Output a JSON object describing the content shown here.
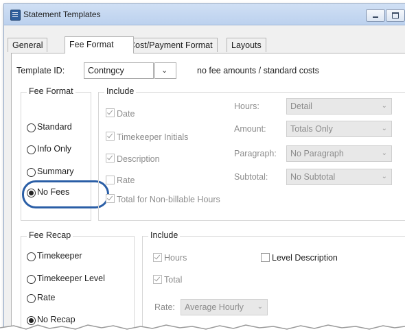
{
  "window": {
    "title": "Statement Templates"
  },
  "tabs": [
    "General",
    "Fee Format",
    "Cost/Payment Format",
    "Layouts"
  ],
  "active_tab": "Fee Format",
  "template": {
    "label": "Template ID:",
    "value": "Contngcy",
    "description": "no fee amounts / standard costs"
  },
  "fee_format": {
    "title": "Fee Format",
    "options": [
      "Standard",
      "Info Only",
      "Summary",
      "No Fees"
    ],
    "selected": "No Fees"
  },
  "include": {
    "title": "Include",
    "checks": [
      {
        "label": "Date",
        "checked": true
      },
      {
        "label": "Timekeeper Initials",
        "checked": true
      },
      {
        "label": "Description",
        "checked": true
      },
      {
        "label": "Rate",
        "checked": false
      },
      {
        "label": "Total for Non-billable Hours",
        "checked": true
      }
    ],
    "fields": [
      {
        "label": "Hours:",
        "value": "Detail"
      },
      {
        "label": "Amount:",
        "value": "Totals Only"
      },
      {
        "label": "Paragraph:",
        "value": "No Paragraph"
      },
      {
        "label": "Subtotal:",
        "value": "No Subtotal"
      }
    ]
  },
  "fee_recap": {
    "title": "Fee Recap",
    "options": [
      "Timekeeper",
      "Timekeeper Level",
      "Rate",
      "No Recap"
    ],
    "selected": "No Recap"
  },
  "recap_include": {
    "title": "Include",
    "hours_label": "Hours",
    "hours_checked": true,
    "level_label": "Level Description",
    "level_checked": false,
    "total_label": "Total",
    "total_checked": true,
    "rate_label": "Rate:",
    "rate_value": "Average Hourly"
  },
  "icons": {
    "window": "template-icon",
    "dropdown": "chevron-down-icon",
    "minimize": "minimize-icon",
    "maximize": "maximize-icon",
    "close": "close-icon"
  },
  "colors": {
    "highlight_ring": "#2a5ea6",
    "titlebar": "#c6d9f1"
  }
}
